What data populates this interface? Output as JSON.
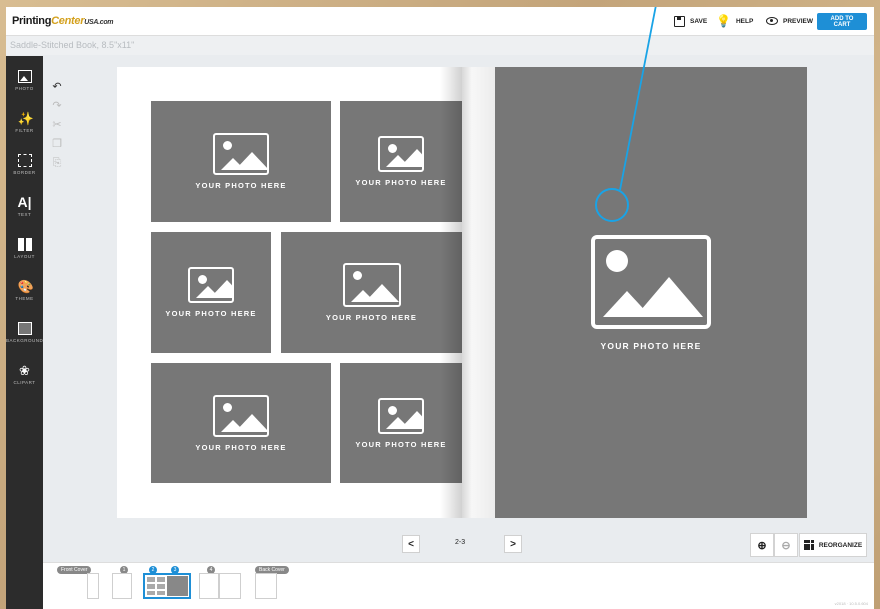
{
  "brand": {
    "part1": "Printing",
    "part2": "Center",
    "part3": "USA.com"
  },
  "toolbar": {
    "save": "SAVE",
    "help": "HELP",
    "preview": "PREVIEW",
    "add_to_cart": "ADD TO CART"
  },
  "product_title": "Saddle-Stitched Book, 8.5\"x11\"",
  "sidebar": {
    "items": [
      {
        "label": "PHOTO",
        "icon": "photo-icon"
      },
      {
        "label": "FILTER",
        "icon": "magic-wand-icon"
      },
      {
        "label": "BORDER",
        "icon": "border-icon"
      },
      {
        "label": "TEXT",
        "icon": "text-icon"
      },
      {
        "label": "LAYOUT",
        "icon": "layout-icon"
      },
      {
        "label": "THEME",
        "icon": "palette-icon"
      },
      {
        "label": "BACKGROUND",
        "icon": "background-icon"
      },
      {
        "label": "CLIPART",
        "icon": "clipart-icon"
      }
    ]
  },
  "placeholder_text": "YOUR PHOTO HERE",
  "pager": {
    "prev": "<",
    "next": ">",
    "current": "2-3"
  },
  "actions": {
    "reorganize": "REORGANIZE"
  },
  "thumbnails": {
    "front_cover": "Front Cover",
    "back_cover": "Back Cover",
    "page_numbers": [
      "1",
      "2",
      "3",
      "4"
    ]
  },
  "version": "v2018 · 10.5.0.604",
  "colors": {
    "accent": "#1e8fd6",
    "placeholder": "#777777",
    "sidebar": "#2c2c2c"
  }
}
